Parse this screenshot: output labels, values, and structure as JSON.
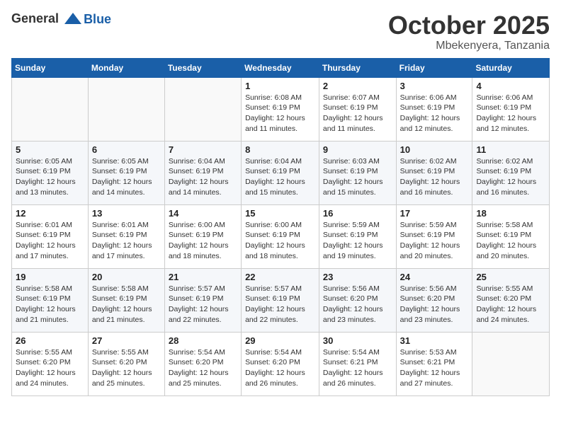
{
  "logo": {
    "line1": "General",
    "line2": "Blue"
  },
  "title": "October 2025",
  "location": "Mbekenyera, Tanzania",
  "days_header": [
    "Sunday",
    "Monday",
    "Tuesday",
    "Wednesday",
    "Thursday",
    "Friday",
    "Saturday"
  ],
  "weeks": [
    [
      {
        "day": "",
        "info": ""
      },
      {
        "day": "",
        "info": ""
      },
      {
        "day": "",
        "info": ""
      },
      {
        "day": "1",
        "info": "Sunrise: 6:08 AM\nSunset: 6:19 PM\nDaylight: 12 hours\nand 11 minutes."
      },
      {
        "day": "2",
        "info": "Sunrise: 6:07 AM\nSunset: 6:19 PM\nDaylight: 12 hours\nand 11 minutes."
      },
      {
        "day": "3",
        "info": "Sunrise: 6:06 AM\nSunset: 6:19 PM\nDaylight: 12 hours\nand 12 minutes."
      },
      {
        "day": "4",
        "info": "Sunrise: 6:06 AM\nSunset: 6:19 PM\nDaylight: 12 hours\nand 12 minutes."
      }
    ],
    [
      {
        "day": "5",
        "info": "Sunrise: 6:05 AM\nSunset: 6:19 PM\nDaylight: 12 hours\nand 13 minutes."
      },
      {
        "day": "6",
        "info": "Sunrise: 6:05 AM\nSunset: 6:19 PM\nDaylight: 12 hours\nand 14 minutes."
      },
      {
        "day": "7",
        "info": "Sunrise: 6:04 AM\nSunset: 6:19 PM\nDaylight: 12 hours\nand 14 minutes."
      },
      {
        "day": "8",
        "info": "Sunrise: 6:04 AM\nSunset: 6:19 PM\nDaylight: 12 hours\nand 15 minutes."
      },
      {
        "day": "9",
        "info": "Sunrise: 6:03 AM\nSunset: 6:19 PM\nDaylight: 12 hours\nand 15 minutes."
      },
      {
        "day": "10",
        "info": "Sunrise: 6:02 AM\nSunset: 6:19 PM\nDaylight: 12 hours\nand 16 minutes."
      },
      {
        "day": "11",
        "info": "Sunrise: 6:02 AM\nSunset: 6:19 PM\nDaylight: 12 hours\nand 16 minutes."
      }
    ],
    [
      {
        "day": "12",
        "info": "Sunrise: 6:01 AM\nSunset: 6:19 PM\nDaylight: 12 hours\nand 17 minutes."
      },
      {
        "day": "13",
        "info": "Sunrise: 6:01 AM\nSunset: 6:19 PM\nDaylight: 12 hours\nand 17 minutes."
      },
      {
        "day": "14",
        "info": "Sunrise: 6:00 AM\nSunset: 6:19 PM\nDaylight: 12 hours\nand 18 minutes."
      },
      {
        "day": "15",
        "info": "Sunrise: 6:00 AM\nSunset: 6:19 PM\nDaylight: 12 hours\nand 18 minutes."
      },
      {
        "day": "16",
        "info": "Sunrise: 5:59 AM\nSunset: 6:19 PM\nDaylight: 12 hours\nand 19 minutes."
      },
      {
        "day": "17",
        "info": "Sunrise: 5:59 AM\nSunset: 6:19 PM\nDaylight: 12 hours\nand 20 minutes."
      },
      {
        "day": "18",
        "info": "Sunrise: 5:58 AM\nSunset: 6:19 PM\nDaylight: 12 hours\nand 20 minutes."
      }
    ],
    [
      {
        "day": "19",
        "info": "Sunrise: 5:58 AM\nSunset: 6:19 PM\nDaylight: 12 hours\nand 21 minutes."
      },
      {
        "day": "20",
        "info": "Sunrise: 5:58 AM\nSunset: 6:19 PM\nDaylight: 12 hours\nand 21 minutes."
      },
      {
        "day": "21",
        "info": "Sunrise: 5:57 AM\nSunset: 6:19 PM\nDaylight: 12 hours\nand 22 minutes."
      },
      {
        "day": "22",
        "info": "Sunrise: 5:57 AM\nSunset: 6:19 PM\nDaylight: 12 hours\nand 22 minutes."
      },
      {
        "day": "23",
        "info": "Sunrise: 5:56 AM\nSunset: 6:20 PM\nDaylight: 12 hours\nand 23 minutes."
      },
      {
        "day": "24",
        "info": "Sunrise: 5:56 AM\nSunset: 6:20 PM\nDaylight: 12 hours\nand 23 minutes."
      },
      {
        "day": "25",
        "info": "Sunrise: 5:55 AM\nSunset: 6:20 PM\nDaylight: 12 hours\nand 24 minutes."
      }
    ],
    [
      {
        "day": "26",
        "info": "Sunrise: 5:55 AM\nSunset: 6:20 PM\nDaylight: 12 hours\nand 24 minutes."
      },
      {
        "day": "27",
        "info": "Sunrise: 5:55 AM\nSunset: 6:20 PM\nDaylight: 12 hours\nand 25 minutes."
      },
      {
        "day": "28",
        "info": "Sunrise: 5:54 AM\nSunset: 6:20 PM\nDaylight: 12 hours\nand 25 minutes."
      },
      {
        "day": "29",
        "info": "Sunrise: 5:54 AM\nSunset: 6:20 PM\nDaylight: 12 hours\nand 26 minutes."
      },
      {
        "day": "30",
        "info": "Sunrise: 5:54 AM\nSunset: 6:21 PM\nDaylight: 12 hours\nand 26 minutes."
      },
      {
        "day": "31",
        "info": "Sunrise: 5:53 AM\nSunset: 6:21 PM\nDaylight: 12 hours\nand 27 minutes."
      },
      {
        "day": "",
        "info": ""
      }
    ]
  ]
}
